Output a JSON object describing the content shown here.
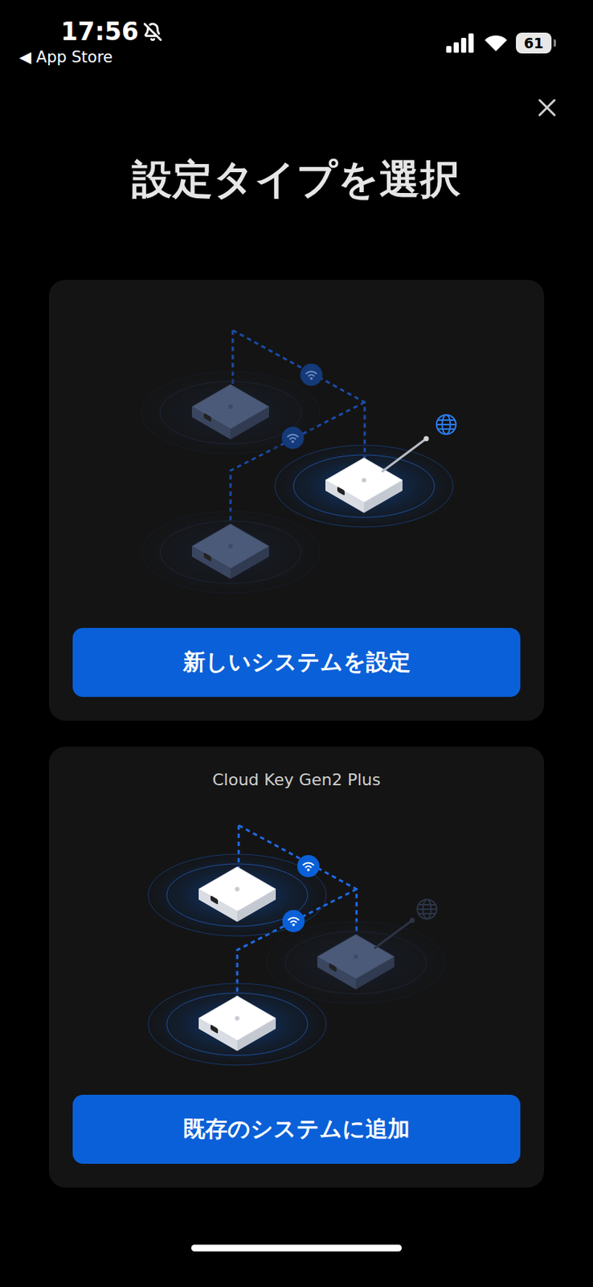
{
  "status_bar": {
    "time": "17:56",
    "silent": true,
    "back": "◀ App Store",
    "battery": "61"
  },
  "title": "設定タイプを選択",
  "options": [
    {
      "kind": "new",
      "button": "新しいシステムを設定"
    },
    {
      "kind": "existing",
      "label": "Cloud Key Gen2 Plus",
      "button": "既存のシステムに追加"
    }
  ]
}
